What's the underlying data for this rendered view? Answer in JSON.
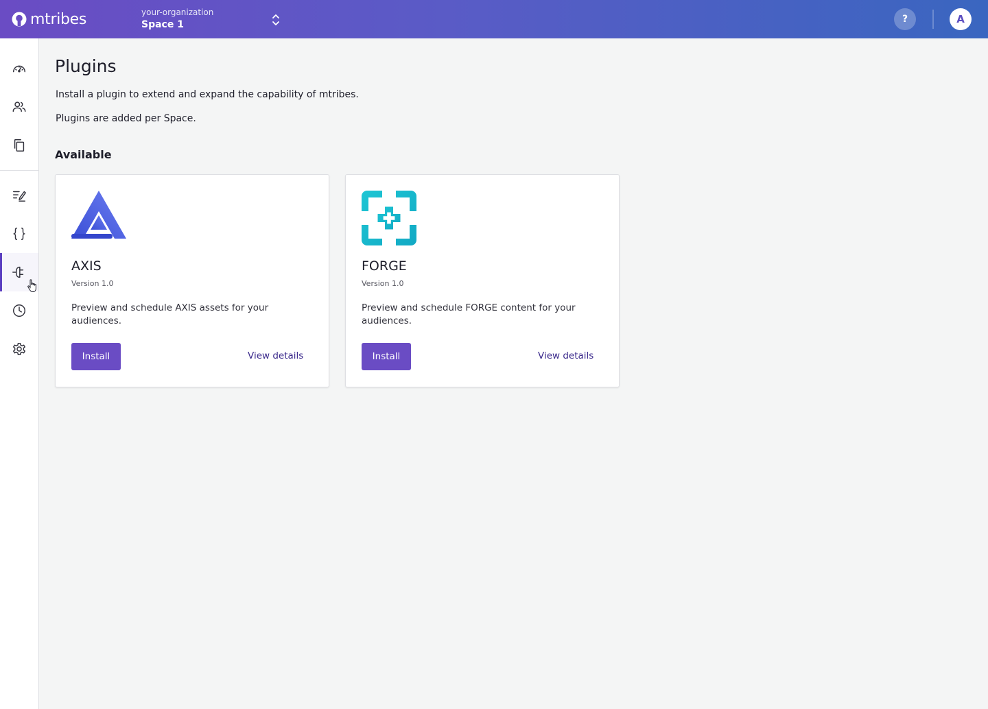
{
  "header": {
    "brand": "mtribes",
    "organization": "your-organization",
    "space": "Space 1",
    "help_label": "?",
    "avatar_initial": "A",
    "colors": {
      "gradient_start": "#6a4cc4",
      "gradient_end": "#3a66c0"
    }
  },
  "sidebar": {
    "items": [
      {
        "icon": "dashboard-gauge-icon",
        "active": false
      },
      {
        "icon": "users-icon",
        "active": false
      },
      {
        "icon": "copy-icon",
        "active": false
      },
      {
        "icon": "edit-list-icon",
        "active": false
      },
      {
        "icon": "code-braces-icon",
        "active": false
      },
      {
        "icon": "plugin-plug-icon",
        "active": true
      },
      {
        "icon": "clock-history-icon",
        "active": false
      },
      {
        "icon": "settings-gear-icon",
        "active": false
      }
    ],
    "accent_color": "#5b3fc0"
  },
  "main": {
    "title": "Plugins",
    "description_1": "Install a plugin to extend and expand the capability of mtribes.",
    "description_2": "Plugins are added per Space.",
    "section_title": "Available",
    "plugins": [
      {
        "name": "AXIS",
        "version": "Version 1.0",
        "description": "Preview and schedule AXIS assets for your audiences.",
        "install_label": "Install",
        "details_label": "View details",
        "logo_icon": "axis-triangle-logo"
      },
      {
        "name": "FORGE",
        "version": "Version 1.0",
        "description": "Preview and schedule FORGE content for your audiences.",
        "install_label": "Install",
        "details_label": "View details",
        "logo_icon": "forge-plus-logo"
      }
    ],
    "button_color": "#6a4cc4"
  }
}
